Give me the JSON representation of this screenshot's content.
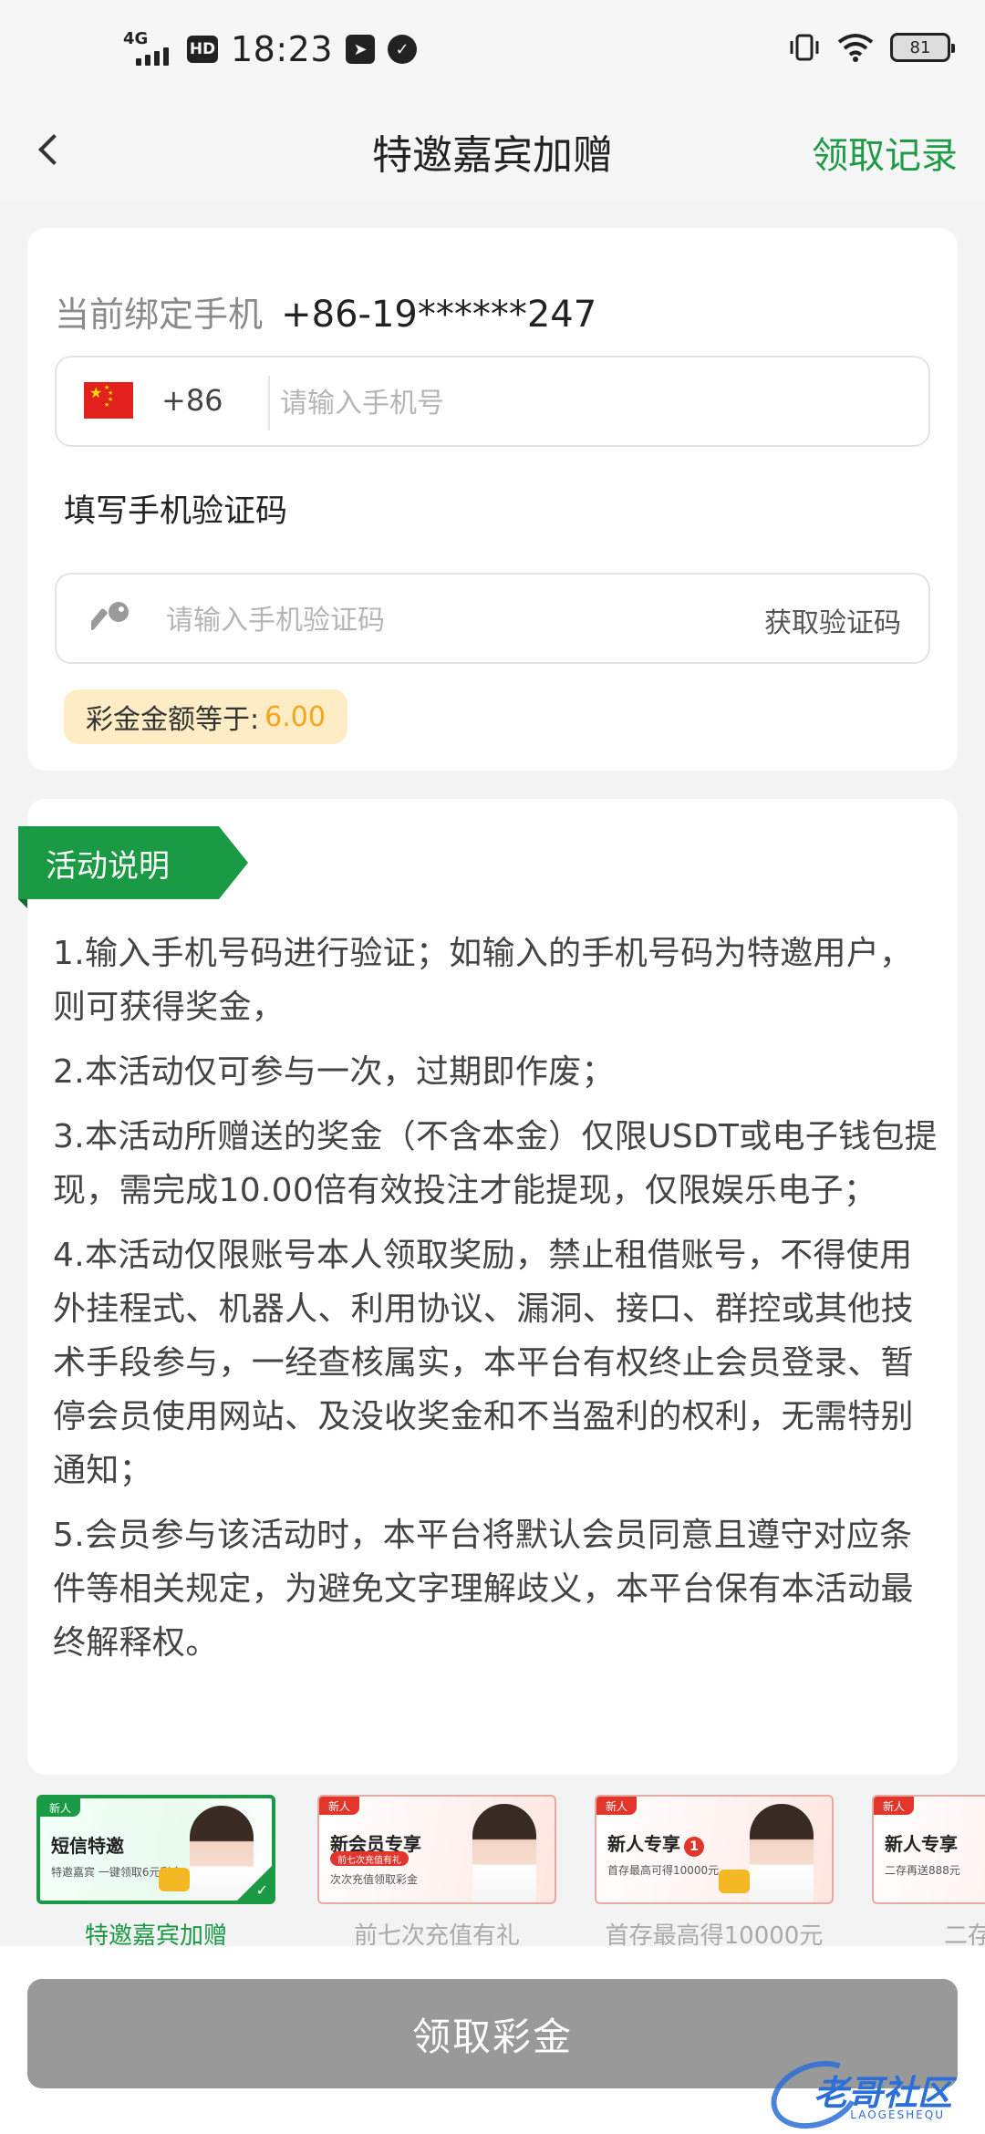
{
  "status_bar": {
    "network": "4G",
    "hd": "HD",
    "time": "18:23",
    "battery": "81"
  },
  "header": {
    "title": "特邀嘉宾加赠",
    "records_label": "领取记录"
  },
  "form": {
    "bound_label": "当前绑定手机",
    "bound_number": "+86-19******247",
    "country_code": "+86",
    "phone_placeholder": "请输入手机号",
    "code_label": "填写手机验证码",
    "code_placeholder": "请输入手机验证码",
    "get_code_label": "获取验证码",
    "bonus_label": "彩金金额等于:",
    "bonus_amount": "6.00"
  },
  "activity": {
    "tag": "活动说明",
    "rules": [
      "1.输入手机号码进行验证；如输入的手机号码为特邀用户，则可获得奖金，",
      "2.本活动仅可参与一次，过期即作废；",
      "3.本活动所赠送的奖金（不含本金）仅限USDT或电子钱包提现，需完成10.00倍有效投注才能提现，仅限娱乐电子；",
      "4.本活动仅限账号本人领取奖励，禁止租借账号，不得使用外挂程式、机器人、利用协议、漏洞、接口、群控或其他技术手段参与，一经查核属实，本平台有权终止会员登录、暂停会员使用网站、及没收奖金和不当盈利的权利，无需特别通知；",
      "5.会员参与该活动时，本平台将默认会员同意且遵守对应条件等相关规定，为避免文字理解歧义，本平台保有本活动最终解释权。"
    ]
  },
  "banners": [
    {
      "new": "新人",
      "title": "短信特邀",
      "sub": "特邀嘉宾 一键领取6元彩金",
      "caption": "特邀嘉宾加赠"
    },
    {
      "new": "新人",
      "title": "新会员专享",
      "pill": "前七次充值有礼",
      "sub": "次次充值领取彩金",
      "caption": "前七次充值有礼"
    },
    {
      "new": "新人",
      "title": "新人专享",
      "badge": "1",
      "sub": "首存最高可得10000元",
      "caption": "首存最高得10000元"
    },
    {
      "new": "新人",
      "title": "新人专享",
      "sub": "二存再送888元",
      "caption": "二存再送"
    }
  ],
  "bottom": {
    "claim_label": "领取彩金",
    "watermark": "老哥社区",
    "watermark_sub": "LAOGESHEQU"
  },
  "colors": {
    "accent": "#1a9a44",
    "bonus_bg": "#fdecc4",
    "bonus_amount": "#f3a51c",
    "button_disabled": "#999999"
  }
}
